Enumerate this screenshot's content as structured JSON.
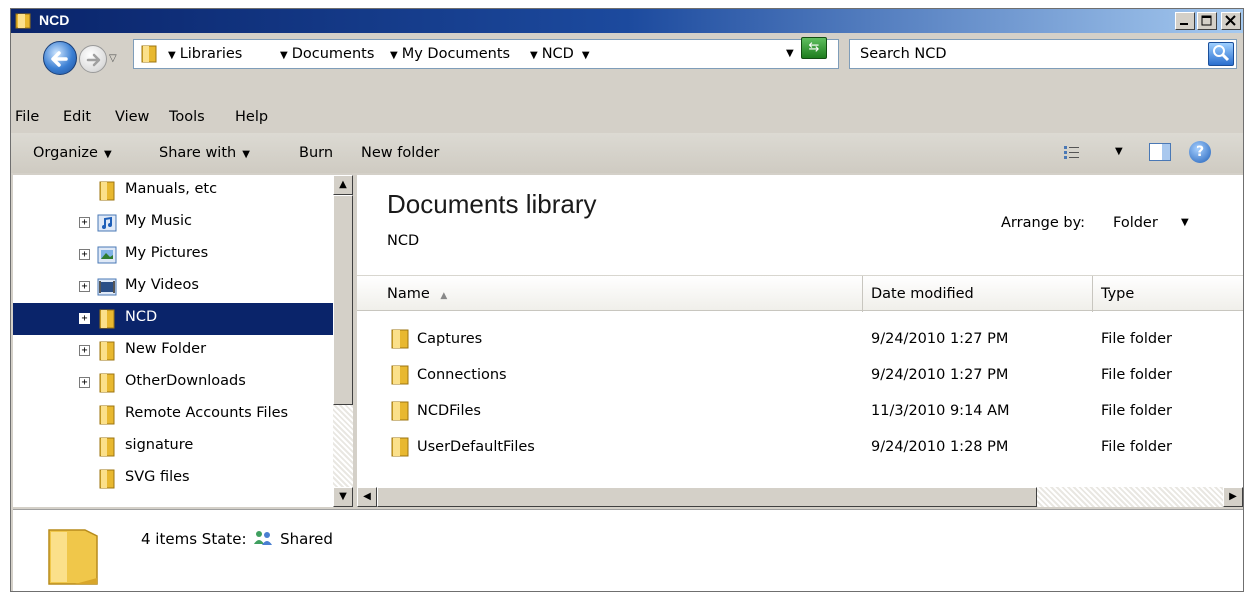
{
  "window": {
    "title": "NCD",
    "controls": {
      "minimize": "_",
      "maximize": "□",
      "close": "×"
    }
  },
  "address": {
    "crumbs": [
      "Libraries",
      "Documents",
      "My Documents",
      "NCD"
    ],
    "search_placeholder": "Search NCD"
  },
  "menu": [
    "File",
    "Edit",
    "View",
    "Tools",
    "Help"
  ],
  "toolbar": {
    "organize": "Organize",
    "share_with": "Share with",
    "burn": "Burn",
    "new_folder": "New folder"
  },
  "nav": {
    "items": [
      {
        "label": "Manuals, etc",
        "icon": "folder-icon",
        "expander": false,
        "selected": false
      },
      {
        "label": "My Music",
        "icon": "music-shortcut-icon",
        "expander": true,
        "selected": false
      },
      {
        "label": "My Pictures",
        "icon": "pictures-shortcut-icon",
        "expander": true,
        "selected": false
      },
      {
        "label": "My Videos",
        "icon": "videos-shortcut-icon",
        "expander": true,
        "selected": false
      },
      {
        "label": "NCD",
        "icon": "folder-icon",
        "expander": true,
        "selected": true
      },
      {
        "label": "New Folder",
        "icon": "folder-icon",
        "expander": true,
        "selected": false
      },
      {
        "label": "OtherDownloads",
        "icon": "folder-icon",
        "expander": true,
        "selected": false
      },
      {
        "label": "Remote Accounts Files",
        "icon": "folder-icon",
        "expander": false,
        "selected": false
      },
      {
        "label": "signature",
        "icon": "folder-icon",
        "expander": false,
        "selected": false
      },
      {
        "label": "SVG files",
        "icon": "folder-icon",
        "expander": false,
        "selected": false
      }
    ]
  },
  "library": {
    "title": "Documents library",
    "subtitle": "NCD",
    "arrange_label": "Arrange by:",
    "arrange_value": "Folder"
  },
  "columns": {
    "name": "Name",
    "date": "Date modified",
    "type": "Type"
  },
  "files": [
    {
      "name": "Captures",
      "date": "9/24/2010 1:27 PM",
      "type": "File folder"
    },
    {
      "name": "Connections",
      "date": "9/24/2010 1:27 PM",
      "type": "File folder"
    },
    {
      "name": "NCDFiles",
      "date": "11/3/2010 9:14 AM",
      "type": "File folder"
    },
    {
      "name": "UserDefaultFiles",
      "date": "9/24/2010 1:28 PM",
      "type": "File folder"
    }
  ],
  "details": {
    "count": "4 items",
    "state_label": "State:",
    "state_value": "Shared"
  },
  "colors": {
    "titlebar": "#0a246a",
    "selection": "#0a246a",
    "folder_yellow": "#f5c542",
    "chrome": "#d4d0c8"
  }
}
